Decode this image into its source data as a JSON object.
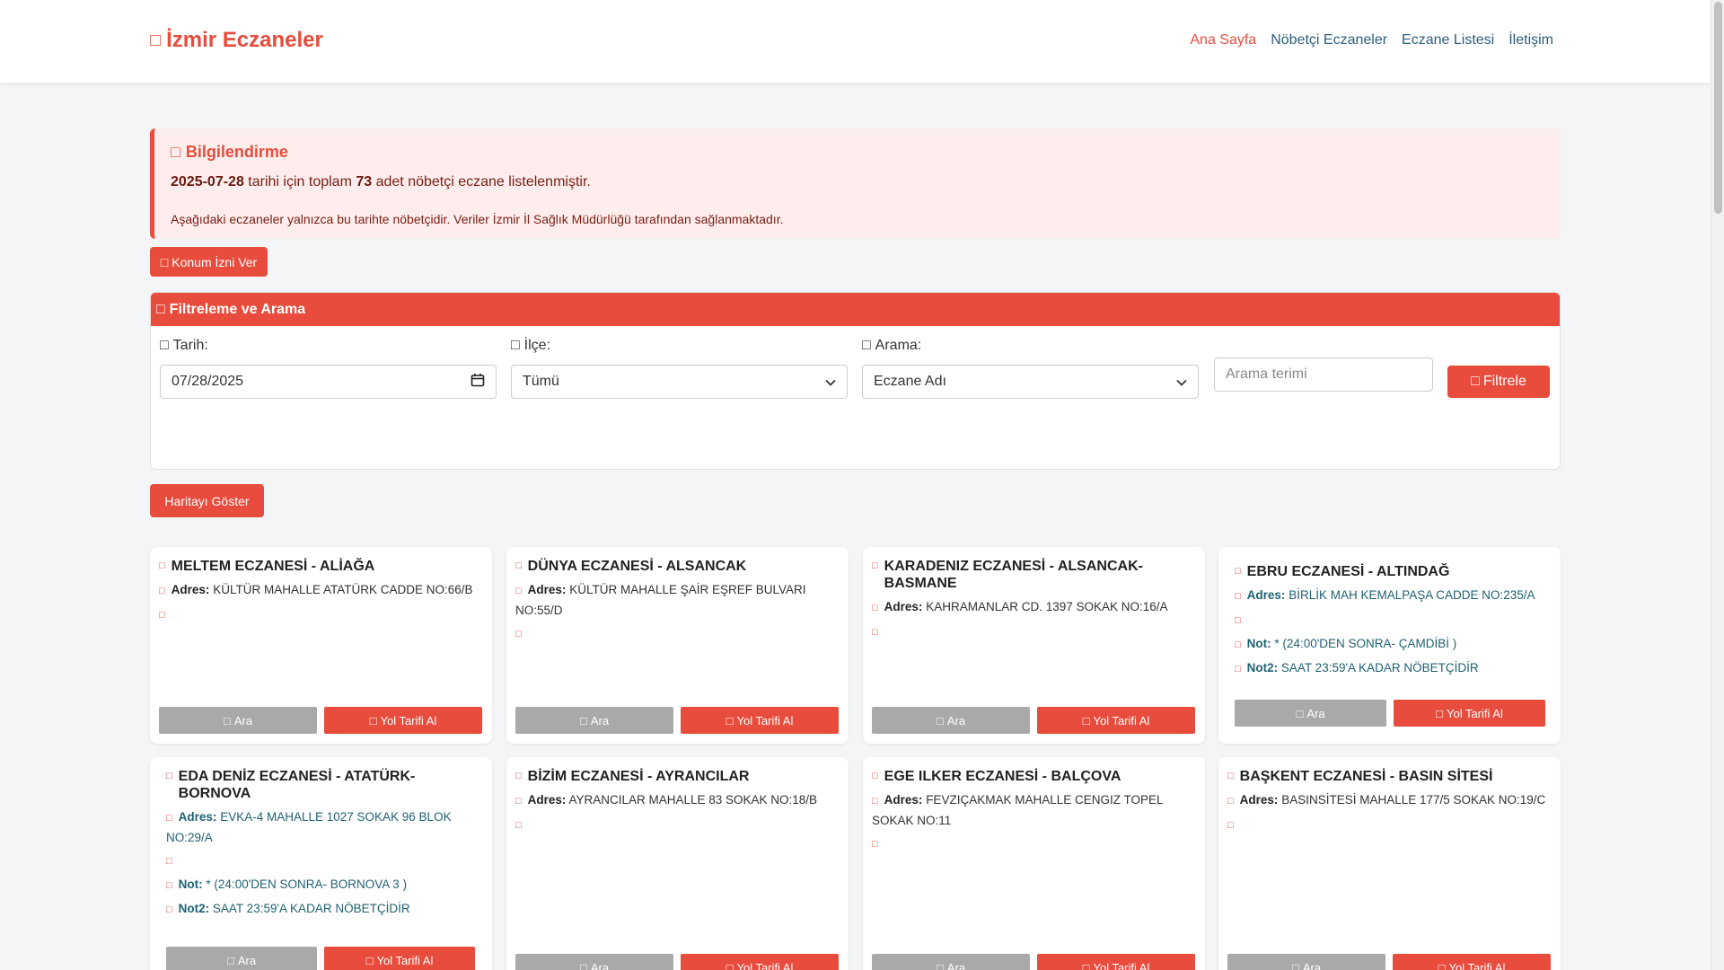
{
  "brand": {
    "icon": "pharmacy-icon",
    "glyph": "□",
    "title": "İzmir Eczaneler"
  },
  "nav": [
    "Ana Sayfa",
    "Nöbetçi Eczaneler",
    "Eczane Listesi",
    "İletişim"
  ],
  "info": {
    "title": "Bilgilendirme",
    "date": "2025-07-28",
    "text1": "tarihi için toplam",
    "count": "73",
    "text2": "adet nöbetçi eczane listelenmiştir.",
    "note": "Aşağıdaki eczaneler yalnızca bu tarihte nöbetçidir. Veriler İzmir İl Sağlık Müdürlüğü tarafından sağlanmaktadır."
  },
  "konum_button": "Konum İzni Ver",
  "filter": {
    "title": "Filtreleme ve Arama",
    "date_label": "Tarih:",
    "date_value": "07/28/2025",
    "district_label": "İlçe:",
    "district_value": "Tümü",
    "search_label": "Arama:",
    "search_type": "Eczane Adı",
    "search_placeholder": "Arama terimi",
    "submit": "Filtrele"
  },
  "map_button": "Haritayı Göster",
  "labels": {
    "address": "Adres:",
    "note": "Not:",
    "note2": "Not2:",
    "call": "Ara",
    "route": "Yol Tarifi Al"
  },
  "pharmacies": [
    {
      "name": "MELTEM ECZANESİ - ALİAĞA",
      "address": "KÜLTÜR MAHALLE ATATÜRK CADDE NO:66/B"
    },
    {
      "name": "DÜNYA ECZANESİ - ALSANCAK",
      "address": "KÜLTÜR MAHALLE ŞAİR EŞREF BULVARI NO:55/D"
    },
    {
      "name": "KARADENIZ ECZANESİ - ALSANCAK-BASMANE",
      "address": "KAHRAMANLAR CD. 1397 SOKAK NO:16/A"
    },
    {
      "name": "EBRU ECZANESİ - ALTINDAĞ",
      "address": "BİRLİK MAH KEMALPAŞA CADDE NO:235/A",
      "note": "* (24:00'DEN SONRA- ÇAMDİBİ )",
      "note2": "SAAT 23:59'A KADAR NÖBETÇİDİR"
    },
    {
      "name": "EDA DENİZ ECZANESİ - ATATÜRK-BORNOVA",
      "address": "EVKA-4 MAHALLE 1027 SOKAK 96 BLOK NO:29/A",
      "note": "* (24:00'DEN SONRA- BORNOVA 3 )",
      "note2": "SAAT 23:59'A KADAR NÖBETÇİDİR"
    },
    {
      "name": "BİZİM ECZANESİ - AYRANCILAR",
      "address": "AYRANCILAR MAHALLE 83 SOKAK NO:18/B"
    },
    {
      "name": "EGE ILKER ECZANESİ - BALÇOVA",
      "address": "FEVZIÇAKMAK MAHALLE CENGIZ TOPEL SOKAK NO:11"
    },
    {
      "name": "BAŞKENT ECZANESİ - BASIN SİTESİ",
      "address": "BASINSİTESİ MAHALLE 177/5 SOKAK NO:19/C"
    }
  ],
  "colors": {
    "accent": "#e74c3c",
    "teal_text": "#1f6173",
    "nav_text": "#2c5d7c"
  }
}
